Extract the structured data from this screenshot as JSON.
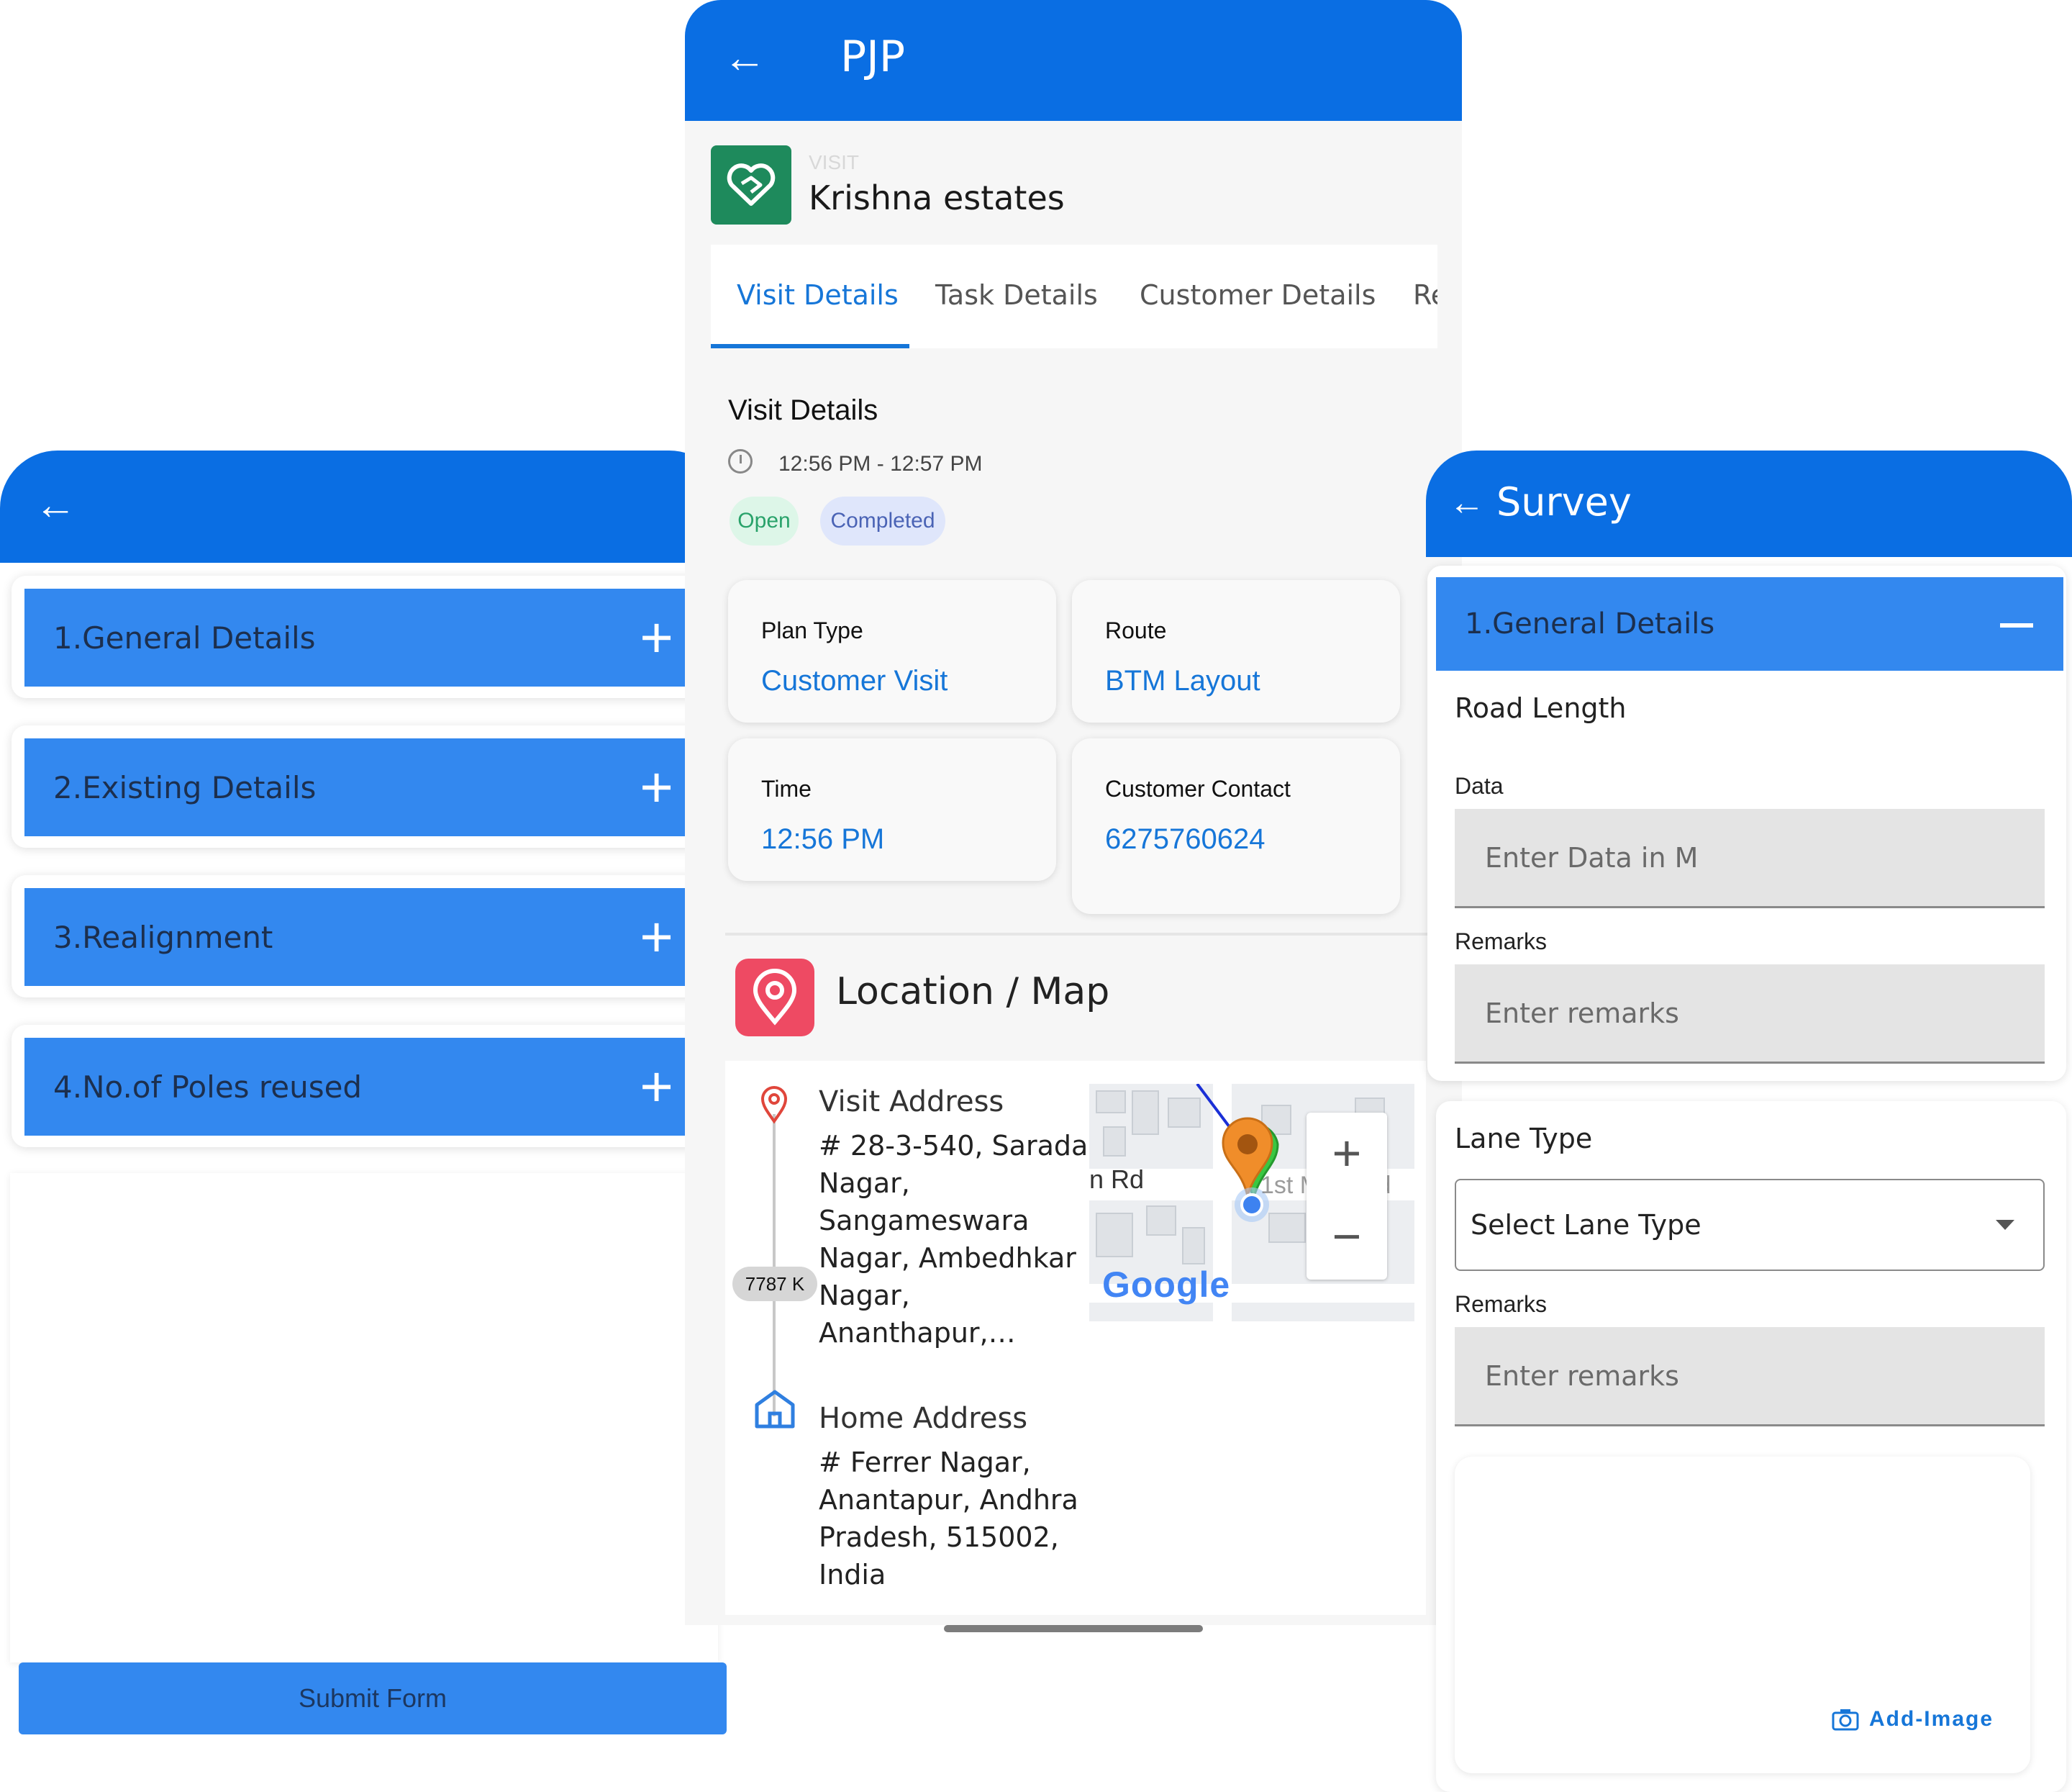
{
  "left_panel": {
    "back_icon": "arrow-left-icon",
    "sections": [
      {
        "label": "1.General Details"
      },
      {
        "label": "2.Existing Details"
      },
      {
        "label": "3.Realignment"
      },
      {
        "label": "4.No.of Poles reused"
      }
    ],
    "expand_icon": "plus-icon",
    "submit_label": "Submit Form"
  },
  "center_panel": {
    "title": "PJP",
    "visit_kicker": "VISIT",
    "visit_name": "Krishna estates",
    "tabs": [
      {
        "label": "Visit Details",
        "active": true
      },
      {
        "label": "Task Details"
      },
      {
        "label": "Customer Details"
      },
      {
        "label": "Re"
      }
    ],
    "visit_details": {
      "title": "Visit Details",
      "time_range": "12:56 PM - 12:57 PM",
      "badges": [
        "Open",
        "Completed"
      ],
      "cards": [
        {
          "label": "Plan Type",
          "value": "Customer Visit"
        },
        {
          "label": "Route",
          "value": "BTM Layout"
        },
        {
          "label": "Time",
          "value": "12:56 PM"
        },
        {
          "label": "Customer Contact",
          "value": "6275760624"
        }
      ]
    },
    "location": {
      "title": "Location / Map",
      "visit_address_title": "Visit Address",
      "visit_address": "# 28-3-540, Sarada Nagar, Sangameswara Nagar, Ambedhkar Nagar, Ananthapur,…",
      "distance": "7787 K",
      "home_address_title": "Home Address",
      "home_address": "# Ferrer Nagar, Anantapur, Andhra Pradesh, 515002, India",
      "map": {
        "road_label_1": "n Rd",
        "road_label_2": "1st Main Rd",
        "zoom_in": "+",
        "zoom_out": "−",
        "brand": "Google"
      }
    }
  },
  "right_panel": {
    "title": "Survey",
    "section_label": "1.General Details",
    "road_length_heading": "Road Length",
    "data_label": "Data",
    "data_placeholder": "Enter Data in M",
    "remarks_label": "Remarks",
    "remarks_placeholder": "Enter remarks",
    "lane_type_heading": "Lane Type",
    "lane_select_value": "Select Lane Type",
    "remarks2_label": "Remarks",
    "remarks2_placeholder": "Enter remarks",
    "add_image_label": "Add-Image"
  },
  "colors": {
    "header_blue": "#0a6ee3",
    "section_blue": "#3388ef",
    "link_blue": "#1676d8",
    "badge_open": "#29a26a",
    "location_red": "#ee4a63",
    "visit_green": "#1e8a5c"
  }
}
